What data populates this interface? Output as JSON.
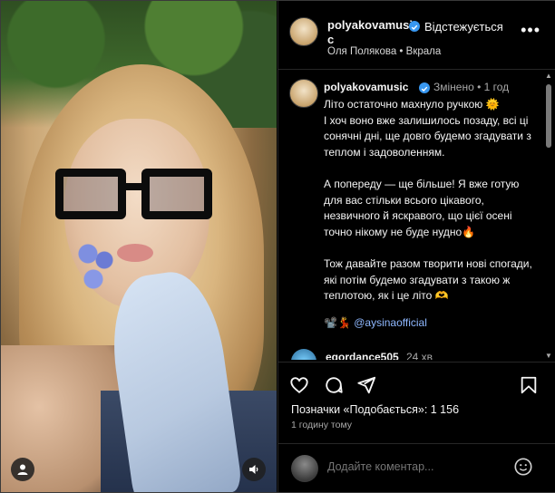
{
  "header": {
    "username": "polyakovamusic",
    "follow_label": "Відстежується",
    "more_label": "•••",
    "subtitle": "Оля Полякова • Вкрала"
  },
  "caption": {
    "username": "polyakovamusic",
    "edited": "Змінено • 1 год",
    "text": "Літо остаточно махнуло ручкою 🌞\nІ хоч воно вже залишилось позаду, всі ці сонячні дні, ще довго будемо згадувати з теплом і задоволенням.\n\nА попереду — ще більше! Я вже готую для вас стільки всього цікавого, незвичного й яскравого, що цієї осені точно нікому не буде нудно🔥\n\nТож давайте разом творити нові спогади, які потім будемо згадувати з такою ж теплотою, як і це літо 🫶",
    "credits_emoji": "📽️💃",
    "credits_tag": "@aysinaofficial"
  },
  "comment": {
    "username": "egordance505",
    "time": "24 хв"
  },
  "actions": {
    "likes_text": "Позначки «Подобається»: 1 156",
    "time_ago": "1 годину тому"
  },
  "add_comment": {
    "placeholder": "Додайте коментар..."
  },
  "colors": {
    "background": "#000000",
    "verified": "#3897f0",
    "link": "#8fb8ff",
    "muted": "#a8a8a8"
  },
  "icons": [
    "user-icon",
    "sound-icon",
    "verified-icon",
    "more-icon",
    "heart-icon",
    "comment-icon",
    "share-icon",
    "bookmark-icon",
    "emoji-icon"
  ]
}
